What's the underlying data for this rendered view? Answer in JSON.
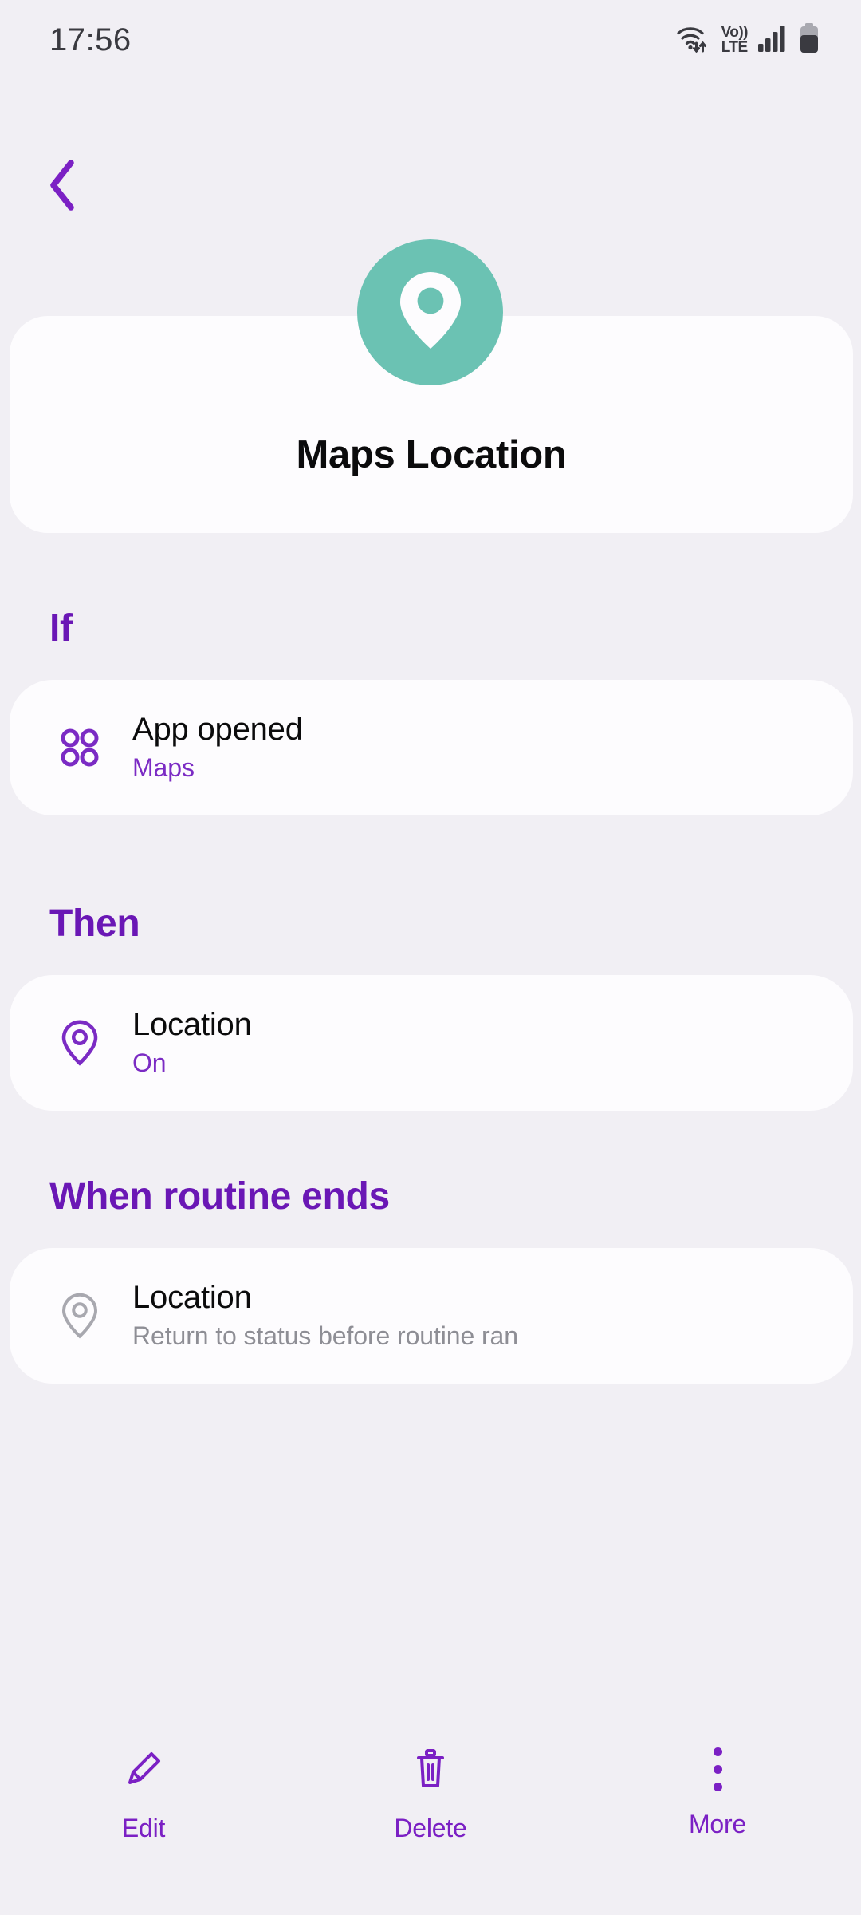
{
  "status_bar": {
    "time": "17:56",
    "icons": {
      "wifi": "wifi-icon",
      "data_arrows": "data-transfer-icon",
      "volte_top": "Vo))",
      "volte_bottom": "LTE",
      "signal": "signal-bars-icon",
      "battery": "battery-icon"
    }
  },
  "navigation": {
    "back_icon": "chevron-left-icon"
  },
  "header": {
    "title": "Maps Location",
    "avatar_icon": "location-pin-icon",
    "avatar_color": "#6BC2B3",
    "avatar_icon_color": "#FDFCFE"
  },
  "sections": [
    {
      "heading": "If",
      "rows": [
        {
          "icon": "apps-grid-icon",
          "icon_color": "#7B2BC4",
          "title": "App opened",
          "subtitle": "Maps",
          "subtitle_muted": false
        }
      ]
    },
    {
      "heading": "Then",
      "rows": [
        {
          "icon": "location-pin-outline-icon",
          "icon_color": "#7B2BC4",
          "title": "Location",
          "subtitle": "On",
          "subtitle_muted": false
        }
      ]
    },
    {
      "heading": "When routine ends",
      "rows": [
        {
          "icon": "location-pin-outline-icon",
          "icon_color": "#A8A8AF",
          "title": "Location",
          "subtitle": "Return to status before routine ran",
          "subtitle_muted": true
        }
      ]
    }
  ],
  "bottom_bar": {
    "items": [
      {
        "icon": "pencil-icon",
        "label": "Edit"
      },
      {
        "icon": "trash-icon",
        "label": "Delete"
      },
      {
        "icon": "more-vertical-icon",
        "label": "More"
      }
    ]
  },
  "theme": {
    "background": "#F1EFF4",
    "card": "#FDFCFE",
    "accent_purple": "#6A17B5",
    "text_primary": "#0B0B0C",
    "text_muted": "#8E8E95"
  }
}
